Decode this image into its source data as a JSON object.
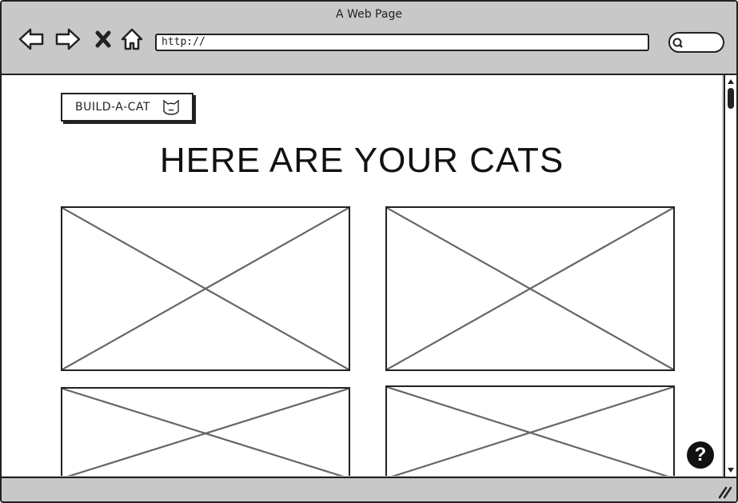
{
  "browser": {
    "title": "A Web Page",
    "url": "http://",
    "nav_icons": [
      "back-arrow-icon",
      "forward-arrow-icon",
      "stop-icon",
      "home-icon"
    ],
    "search_icon": "search-icon"
  },
  "page": {
    "logo_text": "BUILD-A-CAT",
    "logo_icon": "cat-face-icon",
    "heading": "HERE ARE YOUR CATS",
    "images": [
      "image-placeholder",
      "image-placeholder",
      "image-placeholder",
      "image-placeholder"
    ],
    "help_label": "?"
  },
  "colors": {
    "chrome": "#c8c8c8",
    "border": "#222222",
    "placeholder_line": "#666666"
  }
}
